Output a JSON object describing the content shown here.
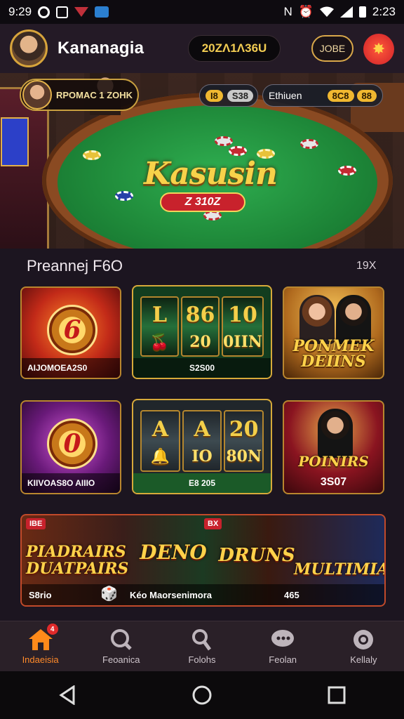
{
  "status_bar": {
    "time_left": "9:29",
    "carrier": "N",
    "time_right": "2:23"
  },
  "header": {
    "user_name": "Kananagia",
    "balance": "20ZΛ1Λ36U",
    "action_label": "JOBE",
    "alert_icon": "star-burst-icon",
    "accent": "#f2cc52"
  },
  "banner": {
    "player_label": "RPOMAC 1 ZOHK",
    "logo_text": "Kasusin",
    "ribbon_text": "Z 310Z",
    "stat_left_a": "I8",
    "stat_left_b": "S38",
    "stat_right_label": "Ethiuen",
    "stat_right_a": "8C8",
    "stat_right_b": "88"
  },
  "section": {
    "title": "Preannej F6O",
    "action": "19X"
  },
  "tiles": [
    {
      "big": "6",
      "caption": "AIJOMOEA2S0"
    },
    {
      "reel1_top": "L",
      "reel1_bottom": "",
      "reel2_top": "86",
      "reel2_bottom": "20",
      "reel3_top": "10",
      "reel3_bottom": "0IIN",
      "caption": "S2S00"
    },
    {
      "title": "PONMEK DEIINS",
      "caption": ""
    },
    {
      "big": "0",
      "caption": "KIIVOAS8O AIIIO"
    },
    {
      "reel1_top": "A",
      "reel1_bottom": "",
      "reel2_top": "A",
      "reel2_bottom": "IO",
      "reel3_top": "20",
      "reel3_bottom": "80N",
      "caption": "E8 205"
    },
    {
      "title": "POINIRS",
      "caption": "3S07"
    }
  ],
  "wide_tile": {
    "tag_left": "IBE",
    "tag_mid": "BX",
    "title1": "PIADRAIRS DUATPAIRS",
    "title2": "DENO",
    "title3": "DRUNS",
    "title4": "MULTIMIAR",
    "bottom_left": "S8rio",
    "bottom_mid": "Kéo Maorsenimora",
    "bottom_right": "465"
  },
  "bottom_nav": {
    "items": [
      {
        "label": "Indaeisia",
        "icon": "home-icon",
        "badge": "4"
      },
      {
        "label": "Feoanica",
        "icon": "search-icon"
      },
      {
        "label": "Folohs",
        "icon": "wrench-icon"
      },
      {
        "label": "Feolan",
        "icon": "chat-icon"
      },
      {
        "label": "Kellaly",
        "icon": "chip-icon"
      }
    ]
  }
}
